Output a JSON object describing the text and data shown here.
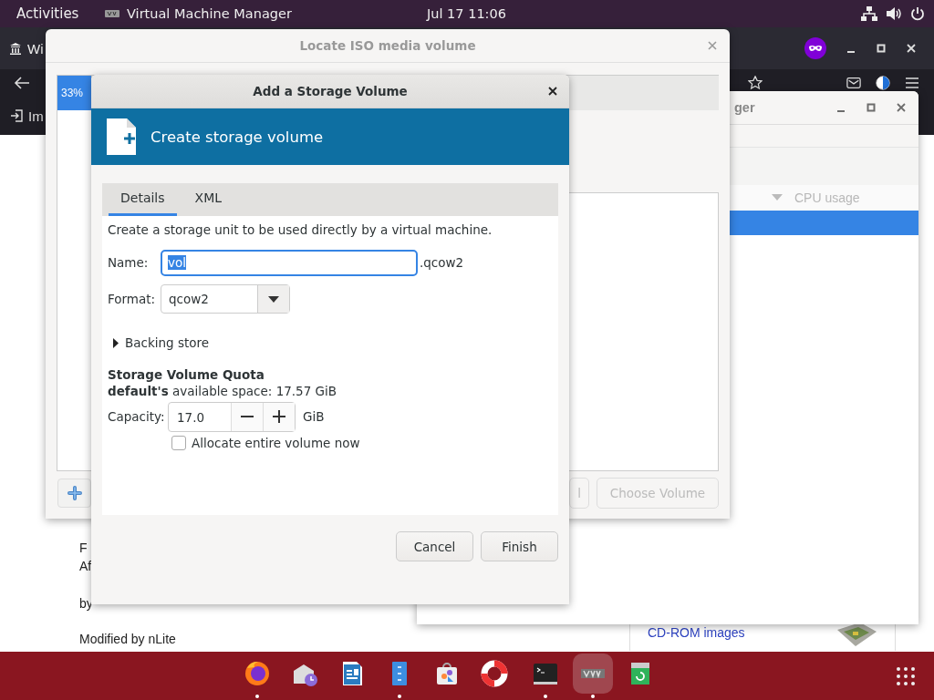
{
  "top_bar": {
    "activities": "Activities",
    "app_name": "Virtual Machine Manager",
    "clock": "Jul 17  11:06"
  },
  "browser": {
    "tab_label": "Wi",
    "bookmark": "Im",
    "page_texts": [
      "F",
      "Af",
      "by",
      "Modified by nLite"
    ],
    "link": "CD-ROM images"
  },
  "manager_window": {
    "title": "ger",
    "column": "CPU usage",
    "rows": [
      {
        "selected": true
      }
    ]
  },
  "iso_dialog": {
    "title": "Locate ISO media volume",
    "pool_usage": "33%",
    "buttons": [
      {
        "label": "l",
        "disabled": true
      },
      {
        "label": "Choose Volume",
        "disabled": true
      }
    ]
  },
  "storage_dialog": {
    "title": "Add a Storage Volume",
    "header": "Create storage volume",
    "tabs": [
      {
        "label": "Details",
        "selected": true
      },
      {
        "label": "XML",
        "selected": false
      }
    ],
    "description": "Create a storage unit to be used directly by a virtual machine.",
    "name": {
      "label": "Name:",
      "value": "vol",
      "suffix": ".qcow2"
    },
    "format": {
      "label": "Format:",
      "value": "qcow2"
    },
    "backing_store": {
      "label": "Backing store",
      "expanded": false
    },
    "quota_title": "Storage Volume Quota",
    "quota_text": "**default's** available space: 17.57 GiB",
    "capacity": {
      "label": "Capacity:",
      "value": "17.0",
      "unit": "GiB"
    },
    "allocate": {
      "label": "Allocate entire volume now",
      "checked": false
    },
    "buttons": [
      "Cancel",
      "Finish"
    ]
  },
  "dock": [
    {
      "kind": "firefox",
      "running": true
    },
    {
      "kind": "mail",
      "running": false
    },
    {
      "kind": "writer",
      "running": false
    },
    {
      "kind": "files",
      "running": true
    },
    {
      "kind": "software",
      "running": false
    },
    {
      "kind": "help",
      "running": false
    },
    {
      "kind": "terminal",
      "running": true
    },
    {
      "kind": "virt",
      "running": true,
      "selected": true
    },
    {
      "kind": "trash",
      "running": false
    }
  ]
}
